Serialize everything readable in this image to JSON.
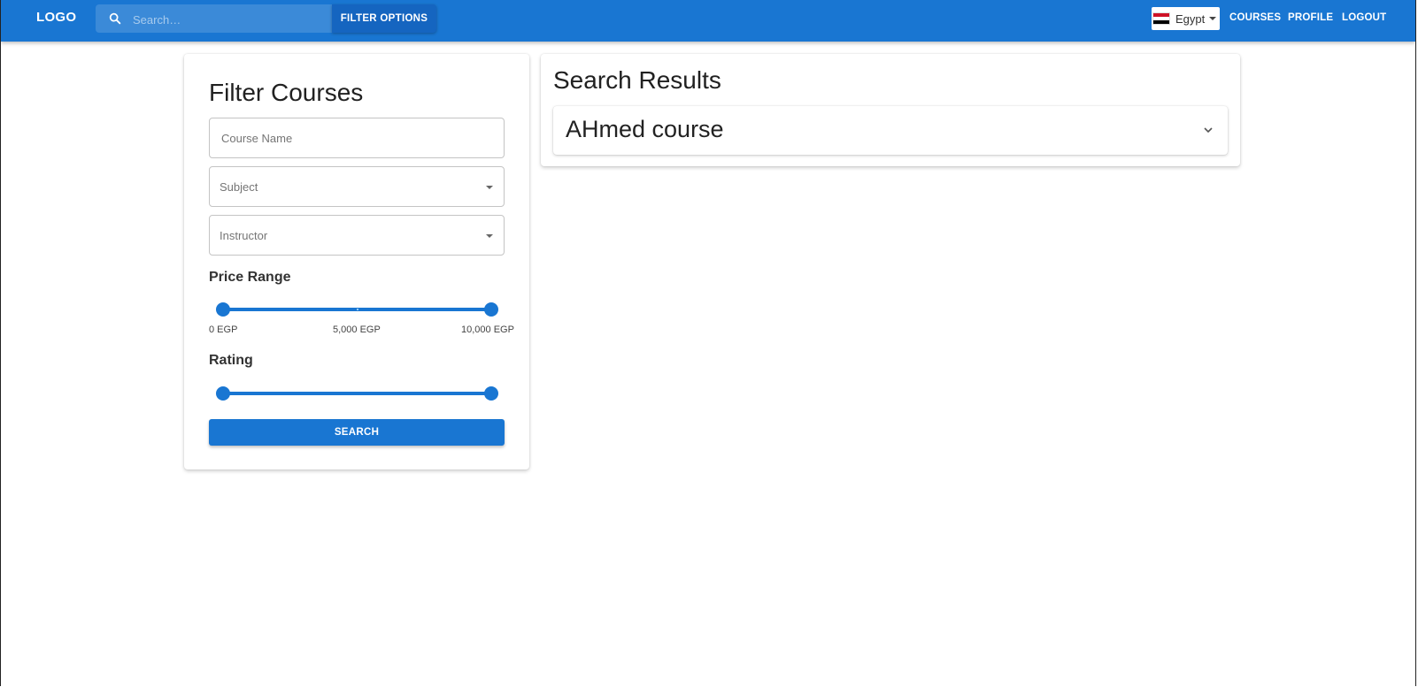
{
  "header": {
    "logo": "LOGO",
    "search_placeholder": "Search…",
    "filter_options_label": "FILTER OPTIONS",
    "country": "Egypt",
    "nav": {
      "courses": "COURSES",
      "profile": "PROFILE",
      "logout": "LOGOUT"
    }
  },
  "filter": {
    "title": "Filter Courses",
    "course_name_placeholder": "Course Name",
    "subject_placeholder": "Subject",
    "instructor_placeholder": "Instructor",
    "price_range": {
      "label": "Price Range",
      "min_value": 0,
      "max_value": 10000,
      "min_label": "0 EGP",
      "mid_label": "5,000 EGP",
      "max_label": "10,000 EGP"
    },
    "rating": {
      "label": "Rating",
      "min_value_fraction": 0,
      "max_value_fraction": 1
    },
    "search_label": "SEARCH"
  },
  "results": {
    "title": "Search Results",
    "items": [
      {
        "name": "AHmed course"
      }
    ]
  },
  "colors": {
    "primary": "#1976d2",
    "primary_dark": "#1565c0"
  }
}
